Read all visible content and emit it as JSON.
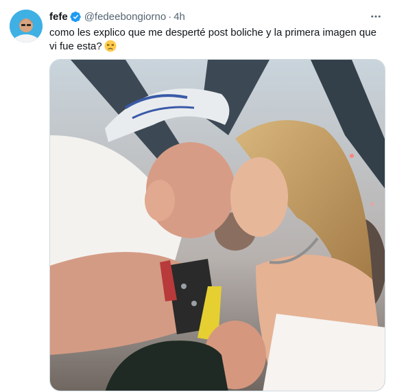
{
  "tweet": {
    "display_name": "fefe",
    "handle": "@fedeebongiorno",
    "separator": "·",
    "time": "4h",
    "text": "como les explico que me desperté post boliche y la primera imagen que vi fue esta?",
    "emoji": "tired-face-emoji"
  },
  "icons": {
    "verified": "verified-badge-icon",
    "more": "more-options-icon"
  },
  "colors": {
    "verified_badge": "#1d9bf0",
    "secondary_text": "#536471",
    "avatar_bg": "#3fb0e3"
  }
}
